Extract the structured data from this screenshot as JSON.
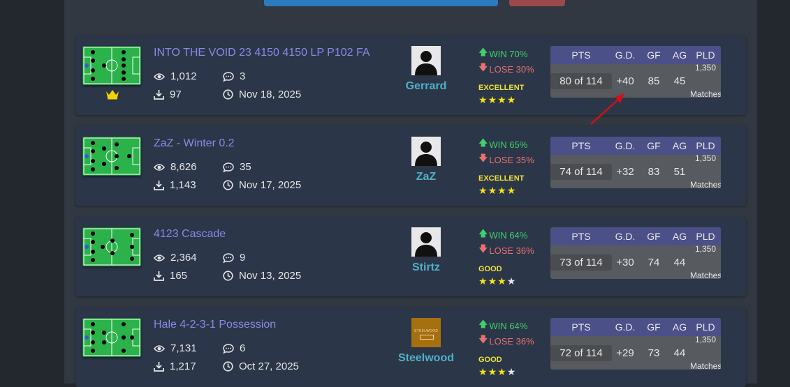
{
  "top_buttons": {
    "blue": "",
    "red": ""
  },
  "tactics": [
    {
      "title": "INTO THE VOID 23 4150 4150 LP P102 FA",
      "views": "1,012",
      "comments": "3",
      "downloads": "97",
      "date": "Nov 18, 2025",
      "author": "Gerrard",
      "win": "WIN 70%",
      "lose": "LOSE 30%",
      "rating": "EXCELLENT",
      "stars": 4,
      "crown": true,
      "stats": {
        "pts": "80 of 114",
        "gd": "+40",
        "gf": "85",
        "ag": "45",
        "pld_num": "1,350",
        "pld_label": "Matches"
      }
    },
    {
      "title": "ZaZ - Winter 0.2",
      "views": "8,626",
      "comments": "35",
      "downloads": "1,143",
      "date": "Nov 17, 2025",
      "author": "ZaZ",
      "win": "WIN 65%",
      "lose": "LOSE 35%",
      "rating": "EXCELLENT",
      "stars": 4,
      "crown": false,
      "stats": {
        "pts": "74 of 114",
        "gd": "+32",
        "gf": "83",
        "ag": "51",
        "pld_num": "1,350",
        "pld_label": "Matches"
      }
    },
    {
      "title": "4123 Cascade",
      "views": "2,364",
      "comments": "9",
      "downloads": "165",
      "date": "Nov 13, 2025",
      "author": "Stirtz",
      "win": "WIN 64%",
      "lose": "LOSE 36%",
      "rating": "GOOD",
      "stars": 3,
      "crown": false,
      "stats": {
        "pts": "73 of 114",
        "gd": "+30",
        "gf": "74",
        "ag": "44",
        "pld_num": "1,350",
        "pld_label": "Matches"
      }
    },
    {
      "title": "Hale 4-2-3-1 Possession",
      "views": "7,131",
      "comments": "6",
      "downloads": "1,217",
      "date": "Oct 27, 2025",
      "author": "Steelwood",
      "win": "WIN 64%",
      "lose": "LOSE 36%",
      "rating": "GOOD",
      "stars": 3,
      "crown": false,
      "stats": {
        "pts": "72 of 114",
        "gd": "+29",
        "gf": "73",
        "ag": "44",
        "pld_num": "1,350",
        "pld_label": "Matches"
      }
    }
  ],
  "table_headers": {
    "pts": "PTS",
    "gd": "G.D.",
    "gf": "GF",
    "ag": "AG",
    "pld": "PLD"
  },
  "avatar_steelwood_text": "STEELWOOD",
  "colors": {
    "title": "#8d87e6",
    "author": "#4fb0c6",
    "win": "#3ed16b",
    "lose": "#e8706f",
    "rating": "#f1e13a",
    "pitch": "#2bb24a",
    "annotation_arrow": "#d0101a"
  },
  "icons": [
    "eye-icon",
    "comment-icon",
    "download-icon",
    "clock-icon",
    "crown-icon",
    "up-arrow-icon",
    "down-arrow-icon",
    "star-icon",
    "avatar-silhouette-icon"
  ]
}
